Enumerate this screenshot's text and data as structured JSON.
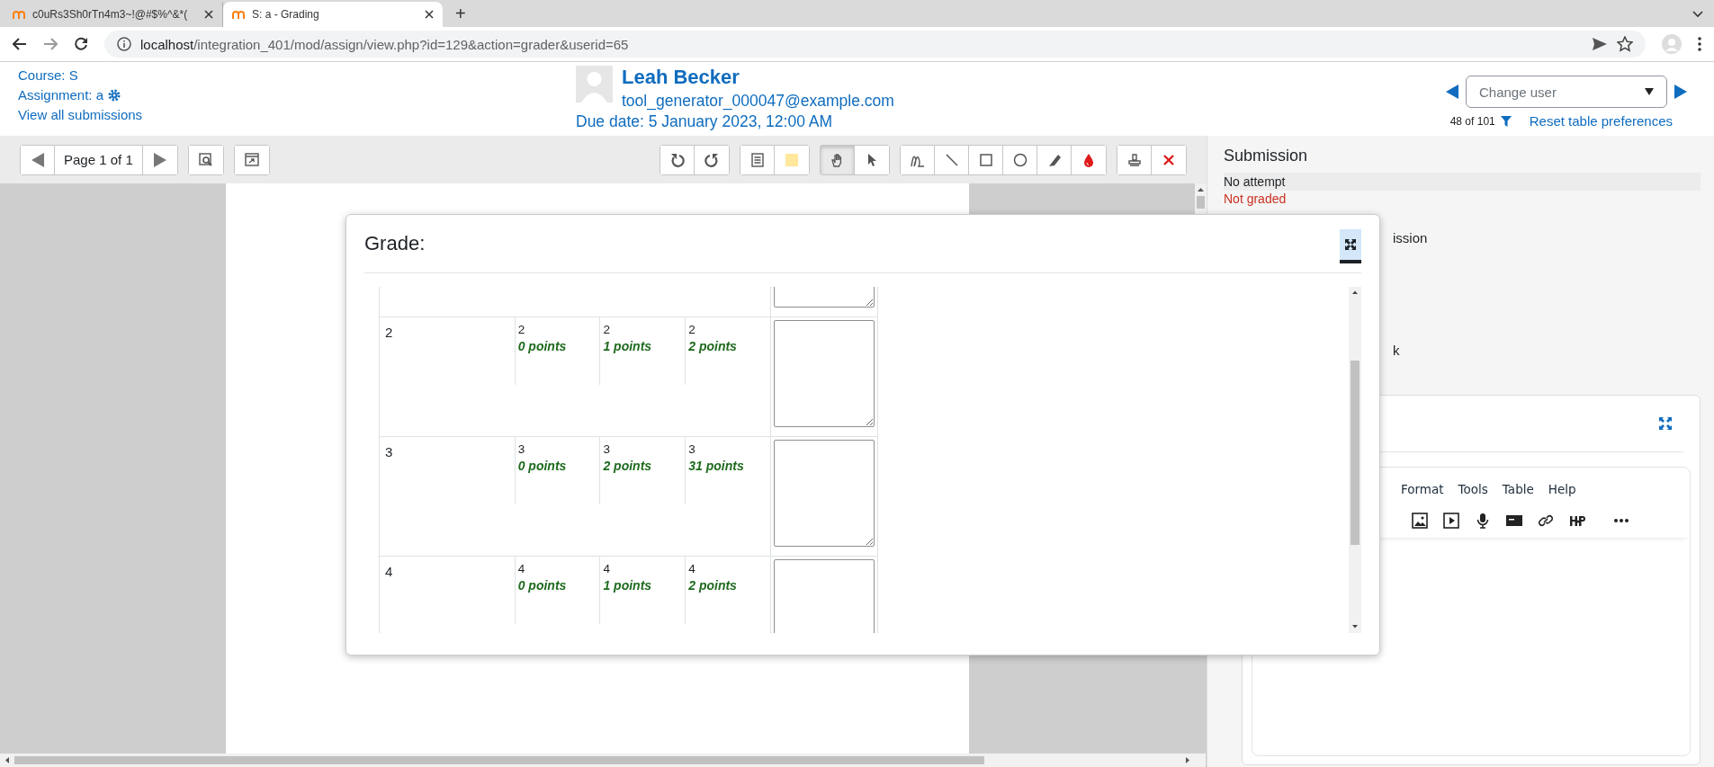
{
  "browser": {
    "tabs": [
      {
        "title": "c0uRs3Sh0rTn4m3~!@#$%^&*(",
        "selected": false
      },
      {
        "title": "S: a - Grading",
        "selected": true
      }
    ],
    "new_tab": "+",
    "url": {
      "host": "localhost",
      "path": "/integration_401/mod/assign/view.php?id=129&action=grader&userid=65"
    }
  },
  "header": {
    "course": "Course: S",
    "assignment": "Assignment: a",
    "view_all": "View all submissions",
    "user": {
      "name": "Leah Becker",
      "email": "tool_generator_000047@example.com"
    },
    "due_date": "Due date: 5 January 2023, 12:00 AM",
    "change_user": {
      "placeholder": "Change user"
    },
    "count": "48 of 101",
    "reset": "Reset table preferences"
  },
  "toolbar": {
    "page": "Page 1 of 1",
    "left_tools": [
      {
        "kind": "search",
        "selected": false
      },
      {
        "kind": "expand",
        "selected": false
      }
    ],
    "groups": [
      {
        "tools": [
          {
            "kind": "rotate-left",
            "selected": false
          },
          {
            "kind": "rotate-right",
            "selected": false
          }
        ]
      },
      {
        "tools": [
          {
            "kind": "comment-list",
            "selected": false
          },
          {
            "kind": "comment-color",
            "selected": false
          }
        ]
      },
      {
        "tools": [
          {
            "kind": "hand",
            "selected": true
          },
          {
            "kind": "select",
            "selected": false
          }
        ]
      },
      {
        "tools": [
          {
            "kind": "pen",
            "selected": false
          },
          {
            "kind": "line",
            "selected": false
          },
          {
            "kind": "rectangle",
            "selected": false
          },
          {
            "kind": "oval",
            "selected": false
          },
          {
            "kind": "highlight",
            "selected": false
          },
          {
            "kind": "color",
            "selected": false
          }
        ]
      },
      {
        "tools": [
          {
            "kind": "stamp",
            "selected": false
          },
          {
            "kind": "delete",
            "selected": false
          }
        ]
      }
    ]
  },
  "submission": {
    "title": "Submission",
    "status": "No attempt",
    "grading": "Not graded",
    "fragment_1": "ission",
    "fragment_2": "k"
  },
  "feedback": {
    "menu": [
      "Format",
      "Tools",
      "Table",
      "Help"
    ],
    "tools": [
      {
        "kind": "image"
      },
      {
        "kind": "media"
      },
      {
        "kind": "audio"
      },
      {
        "kind": "video"
      },
      {
        "kind": "link"
      },
      {
        "kind": "h5p"
      },
      {
        "kind": "more"
      }
    ]
  },
  "grade_modal": {
    "title": "Grade:",
    "rows": [
      {
        "criterion": "2",
        "levels": [
          {
            "score": "2",
            "points": "0 points"
          },
          {
            "score": "2",
            "points": "1 points"
          },
          {
            "score": "2",
            "points": "2 points"
          }
        ]
      },
      {
        "criterion": "3",
        "levels": [
          {
            "score": "3",
            "points": "0 points"
          },
          {
            "score": "3",
            "points": "2 points"
          },
          {
            "score": "3",
            "points": "31 points"
          }
        ]
      },
      {
        "criterion": "4",
        "levels": [
          {
            "score": "4",
            "points": "0 points"
          },
          {
            "score": "4",
            "points": "1 points"
          },
          {
            "score": "4",
            "points": "2 points"
          }
        ]
      }
    ]
  }
}
